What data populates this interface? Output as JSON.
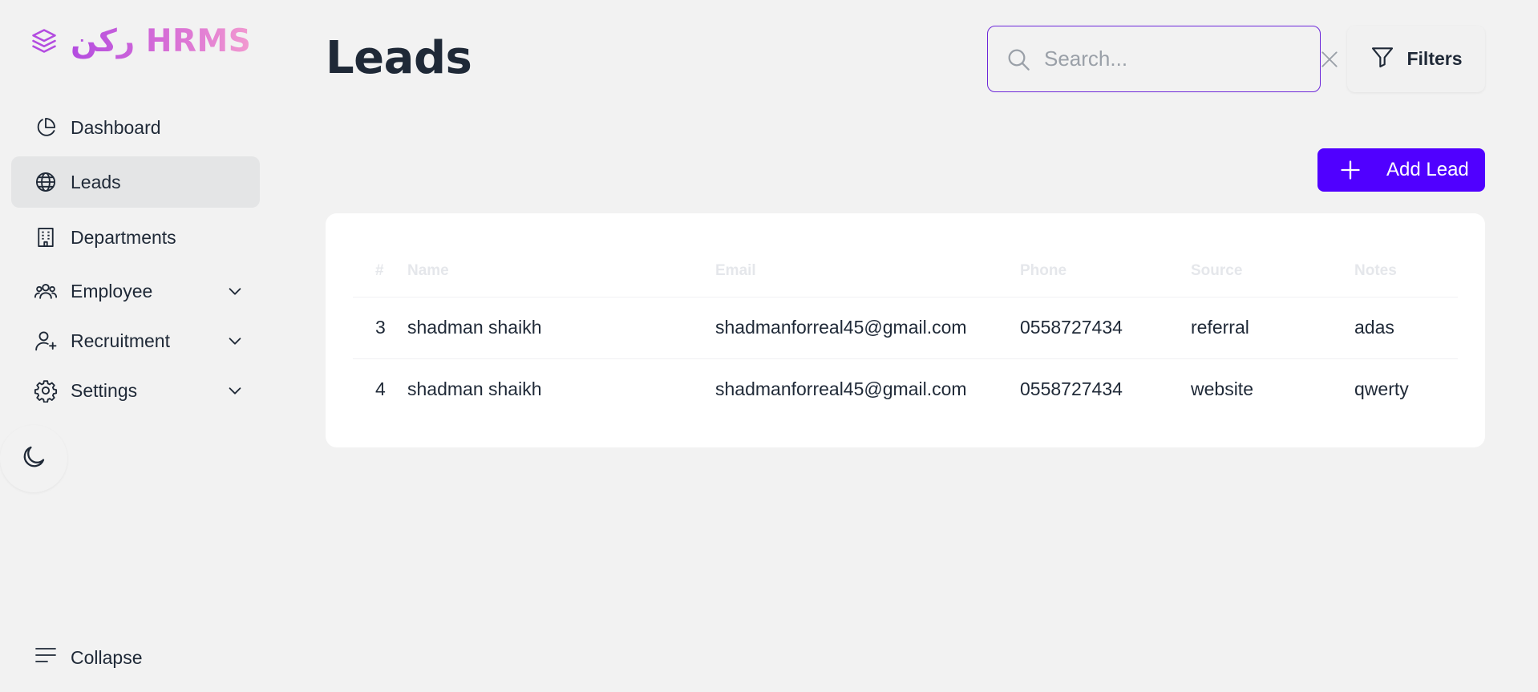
{
  "brand": {
    "arabic": "ركن",
    "name": "HRMS"
  },
  "sidebar": {
    "items": [
      {
        "label": "Dashboard",
        "icon": "pie-chart-icon",
        "active": false
      },
      {
        "label": "Leads",
        "icon": "globe-icon",
        "active": true
      },
      {
        "label": "Departments",
        "icon": "building-icon",
        "active": false
      },
      {
        "label": "Employee",
        "icon": "users-icon",
        "expandable": true
      },
      {
        "label": "Recruitment",
        "icon": "user-plus-icon",
        "expandable": true
      },
      {
        "label": "Settings",
        "icon": "gear-icon",
        "expandable": true
      }
    ],
    "theme_toggle_icon": "moon-icon",
    "collapse_label": "Collapse"
  },
  "header": {
    "title": "Leads",
    "search_placeholder": "Search...",
    "filters_label": "Filters",
    "add_lead_label": "Add Lead"
  },
  "table": {
    "columns": [
      "#",
      "Name",
      "Email",
      "Phone",
      "Source",
      "Notes"
    ],
    "rows": [
      [
        "3",
        "shadman shaikh",
        "shadmanforreal45@gmail.com",
        "0558727434",
        "referral",
        "adas"
      ],
      [
        "4",
        "shadman shaikh",
        "shadmanforreal45@gmail.com",
        "0558727434",
        "website",
        "qwerty"
      ]
    ]
  },
  "colors": {
    "accent": "#5000ff",
    "search_border": "#6d28d9",
    "brand_gradient_start": "#b34ce0",
    "brand_gradient_end": "#f29ad0",
    "background": "#f2f2f2"
  }
}
